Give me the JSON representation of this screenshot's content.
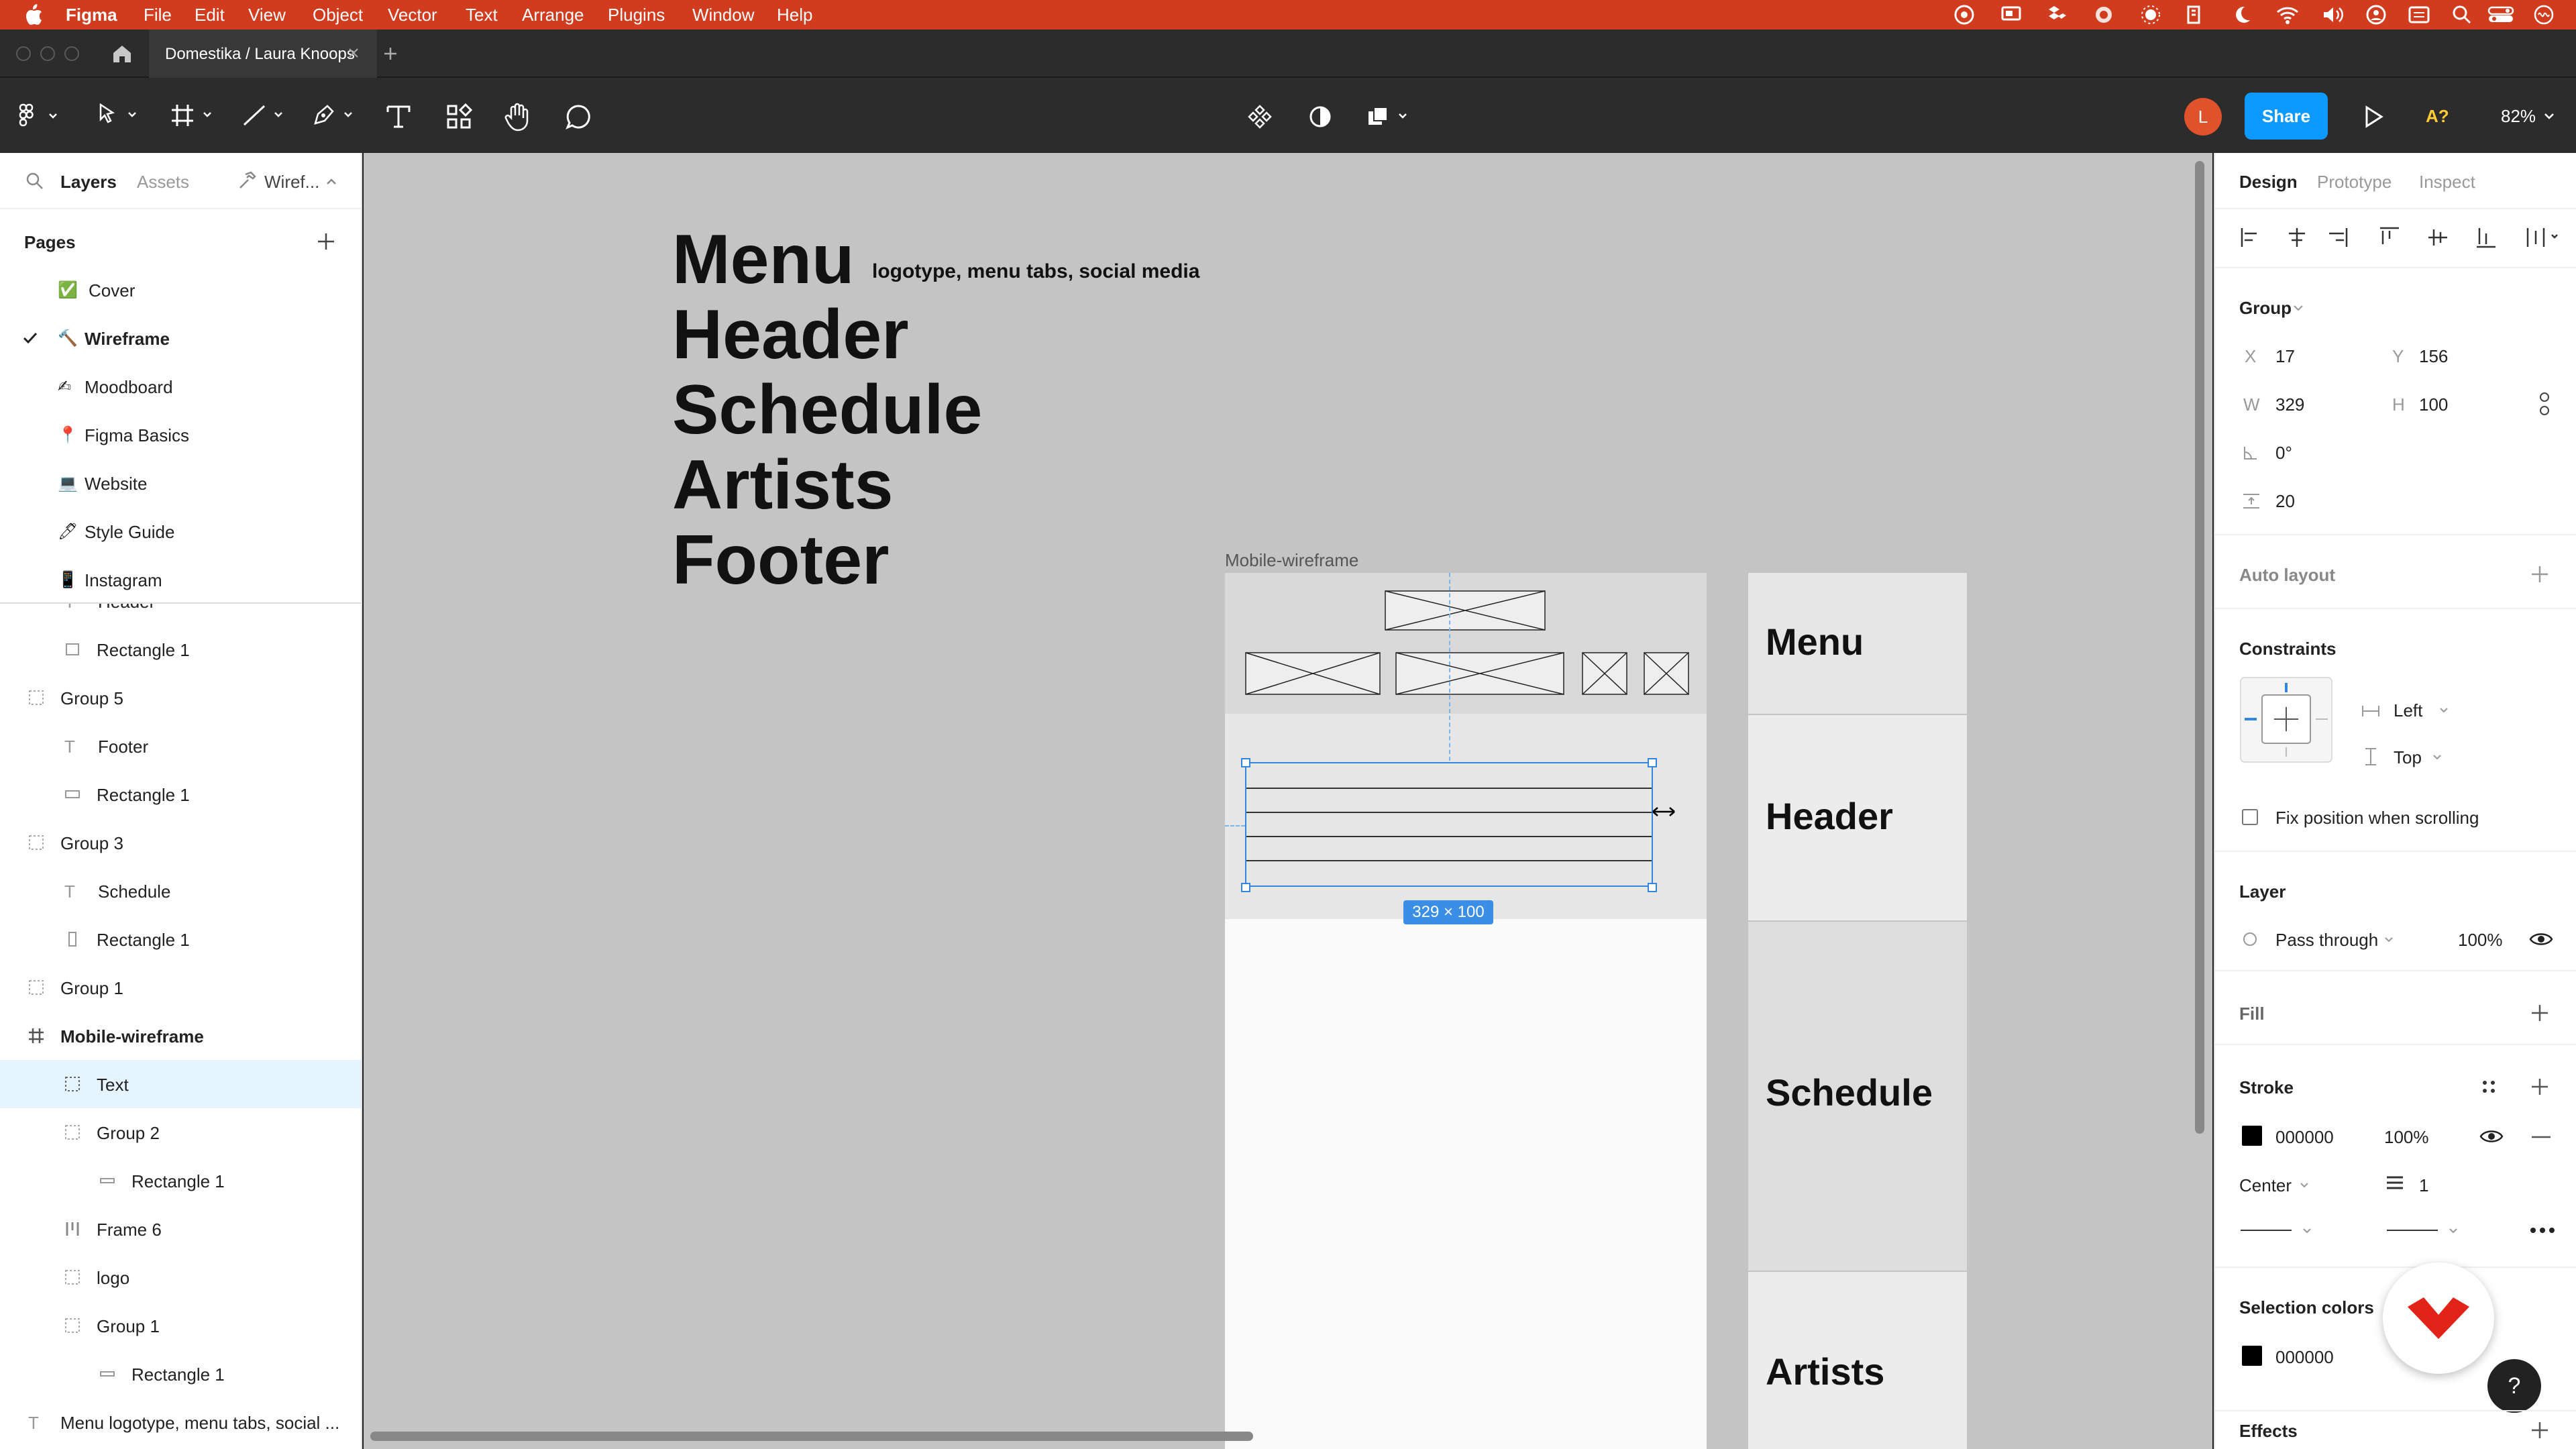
{
  "menubar": {
    "app": "Figma",
    "items": [
      "File",
      "Edit",
      "View",
      "Object",
      "Vector",
      "Text",
      "Arrange",
      "Plugins",
      "Window",
      "Help"
    ]
  },
  "tab": {
    "title": "Domestika / Laura Knoops"
  },
  "toolbar": {
    "avatar": "L",
    "share": "Share",
    "font_check": "A?",
    "zoom": "82%"
  },
  "left": {
    "tabs": {
      "layers": "Layers",
      "assets": "Assets",
      "page": "Wiref..."
    },
    "pages_title": "Pages",
    "pages": [
      {
        "icon": "✅",
        "label": "Cover"
      },
      {
        "icon": "🔨",
        "label": "Wireframe"
      },
      {
        "icon": "✍",
        "label": "Moodboard"
      },
      {
        "icon": "📍",
        "label": "Figma Basics"
      },
      {
        "icon": "💻",
        "label": "Website"
      },
      {
        "icon": "🖊",
        "label": "Style Guide"
      },
      {
        "icon": "📱",
        "label": "Instagram"
      }
    ],
    "layers": [
      {
        "label": "Header"
      },
      {
        "label": "Rectangle 1"
      },
      {
        "label": "Group 5"
      },
      {
        "label": "Footer"
      },
      {
        "label": "Rectangle 1"
      },
      {
        "label": "Group 3"
      },
      {
        "label": "Schedule"
      },
      {
        "label": "Rectangle 1"
      },
      {
        "label": "Group 1"
      },
      {
        "label": "Mobile-wireframe"
      },
      {
        "label": "Text"
      },
      {
        "label": "Group 2"
      },
      {
        "label": "Rectangle 1"
      },
      {
        "label": "Frame 6"
      },
      {
        "label": "logo"
      },
      {
        "label": "Group 1"
      },
      {
        "label": "Rectangle 1"
      },
      {
        "label": "Menu logotype, menu tabs, social ..."
      }
    ]
  },
  "canvas": {
    "words": [
      "Menu",
      "Header",
      "Schedule",
      "Artists",
      "Footer"
    ],
    "menu_note": "logotype, menu tabs, social media",
    "frame_label": "Mobile-wireframe",
    "size_badge": "329 × 100",
    "sections": [
      "Menu",
      "Header",
      "Schedule",
      "Artists"
    ]
  },
  "right": {
    "tabs": {
      "design": "Design",
      "prototype": "Prototype",
      "inspect": "Inspect"
    },
    "group_title": "Group",
    "x_label": "X",
    "x": "17",
    "y_label": "Y",
    "y": "156",
    "w_label": "W",
    "w": "329",
    "h_label": "H",
    "h": "100",
    "rotation": "0°",
    "spacing": "20",
    "auto_layout": "Auto layout",
    "constraints": "Constraints",
    "constraint_h": "Left",
    "constraint_v": "Top",
    "fix_position": "Fix position when scrolling",
    "layer": "Layer",
    "blend": "Pass through",
    "opacity": "100%",
    "fill": "Fill",
    "stroke": "Stroke",
    "stroke_color": "000000",
    "stroke_opacity": "100%",
    "stroke_align": "Center",
    "stroke_weight": "1",
    "selection_colors": "Selection colors",
    "sel_color": "000000",
    "effects": "Effects"
  },
  "colors": {
    "menubar": "#d13c1f",
    "accent": "#0d99ff",
    "avatar": "#e0522b",
    "domestika": "#e2231a"
  }
}
